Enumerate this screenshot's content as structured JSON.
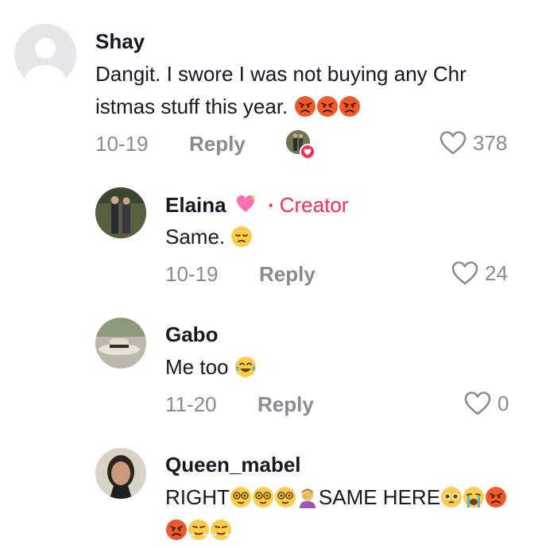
{
  "comments": [
    {
      "username": "Shay",
      "text_line1": "Dangit. I swore I was not buying any Chr",
      "text_line2": "istmas stuff this year.",
      "date": "10-19",
      "reply_label": "Reply",
      "likes": "378"
    },
    {
      "username": "Elaina",
      "creator_label": "Creator",
      "text": "Same.",
      "date": "10-19",
      "reply_label": "Reply",
      "likes": "24"
    },
    {
      "username": "Gabo",
      "text": "Me too",
      "date": "11-20",
      "reply_label": "Reply",
      "likes": "0"
    },
    {
      "username": "Queen_mabel",
      "text_part1": "RIGHT",
      "text_part2": "SAME HERE"
    }
  ],
  "colors": {
    "accent": "#fe2c55",
    "muted": "#8a8b91",
    "text": "#161823"
  }
}
